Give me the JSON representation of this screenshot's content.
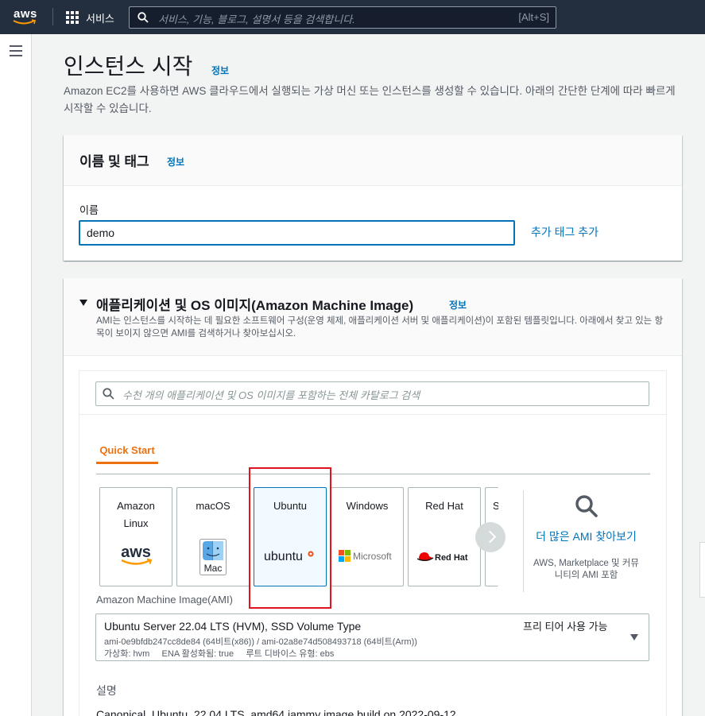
{
  "topnav": {
    "logo_text": "aws",
    "services_label": "서비스",
    "search_placeholder": "서비스, 기능, 블로그, 설명서 등을 검색합니다.",
    "search_shortcut": "[Alt+S]"
  },
  "page": {
    "title": "인스턴스 시작",
    "info": "정보",
    "description": "Amazon EC2를 사용하면 AWS 클라우드에서 실행되는 가상 머신 또는 인스턴스를 생성할 수 있습니다. 아래의 간단한 단계에 따라 빠르게 시작할 수 있습니다."
  },
  "name_tags": {
    "heading": "이름 및 태그",
    "info": "정보",
    "name_label": "이름",
    "name_value": "demo",
    "add_tags_link": "추가 태그 추가"
  },
  "ami": {
    "heading": "애플리케이션 및 OS 이미지(Amazon Machine Image)",
    "info": "정보",
    "subtitle": "AMI는 인스턴스를 시작하는 데 필요한 소프트웨어 구성(운영 체제, 애플리케이션 서버 및 애플리케이션)이 포함된 템플릿입니다. 아래에서 찾고 있는 항목이 보이지 않으면 AMI를 검색하거나 찾아보십시오.",
    "search_placeholder": "수천 개의 애플리케이션 및 OS 이미지를 포함하는 전체 카탈로그 검색",
    "tab_quick_start": "Quick Start",
    "os_cards": [
      {
        "label_line1": "Amazon",
        "label_line2": "Linux",
        "logo": "aws"
      },
      {
        "label_line1": "macOS",
        "label_line2": "",
        "logo": "Mac"
      },
      {
        "label_line1": "Ubuntu",
        "label_line2": "",
        "logo": "ubuntu"
      },
      {
        "label_line1": "Windows",
        "label_line2": "",
        "logo": "Microsoft"
      },
      {
        "label_line1": "Red Hat",
        "label_line2": "",
        "logo": "Red Hat"
      },
      {
        "label_line1": "S",
        "label_line2": "",
        "logo": ""
      }
    ],
    "more_ami_link": "더 많은 AMI 찾아보기",
    "more_ami_note": "AWS, Marketplace 및 커뮤니티의 AMI 포함",
    "ami_label": "Amazon Machine Image(AMI)",
    "selected_ami": "Ubuntu Server 22.04 LTS (HVM), SSD Volume Type",
    "free_tier": "프리 티어 사용 가능",
    "ami_ids": "ami-0e9bfdb247cc8de84 (64비트(x86)) / ami-02a8e74d508493718 (64비트(Arm))",
    "ami_meta": "가상화: hvm     ENA 활성화됨: true     루트 디바이스 유형: ebs",
    "description_label": "설명",
    "description_text": "Canonical, Ubuntu, 22.04 LTS, amd64 jammy image build on 2022-09-12"
  },
  "colors": {
    "nav_bg": "#232f3e",
    "link": "#0073bb",
    "accent_orange": "#ec7211",
    "highlight_red": "#e0141e"
  }
}
